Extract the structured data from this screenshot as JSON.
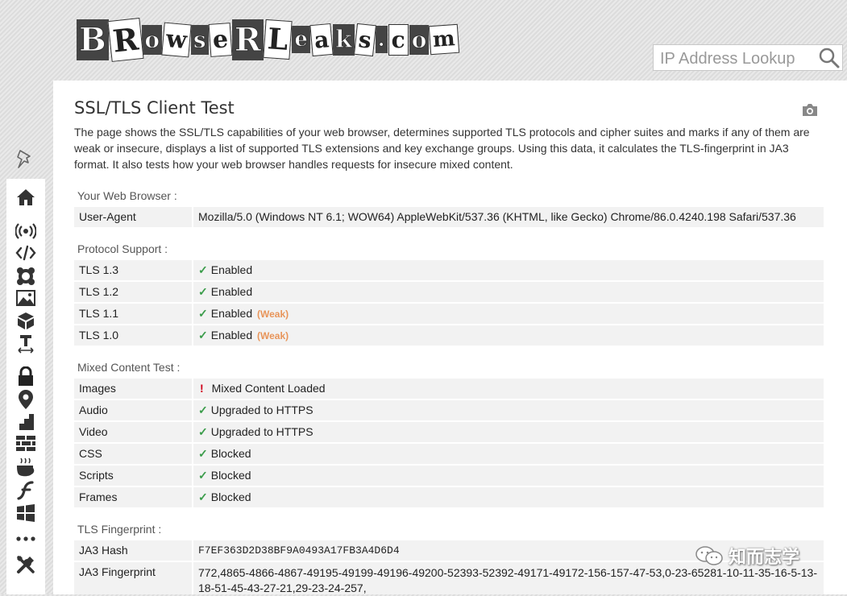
{
  "logo": {
    "letters": [
      "B",
      "R",
      "o",
      "w",
      "s",
      "e",
      "R",
      "L",
      "e",
      "a",
      "k",
      "s",
      ".",
      "c",
      "o",
      "m"
    ]
  },
  "search": {
    "placeholder": "IP Address Lookup"
  },
  "sidebar": {
    "icons": [
      "home-icon",
      "broadcast-icon",
      "code-icon",
      "flower-icon",
      "image-icon",
      "cube-icon",
      "text-size-icon",
      "lock-icon",
      "location-pin-icon",
      "bar-chart-icon",
      "brick-wall-icon",
      "coffee-icon",
      "flash-icon",
      "windows-icon",
      "more-icon",
      "tools-icon"
    ]
  },
  "page": {
    "title": "SSL/TLS Client Test",
    "description": "The page shows the SSL/TLS capabilities of your web browser, determines supported TLS protocols and cipher suites and marks if any of them are weak or insecure, displays a list of supported TLS extensions and key exchange groups. Using this data, it calculates the TLS-fingerprint in JA3 format. It also tests how your web browser handles requests for insecure mixed content."
  },
  "sections": {
    "browser": {
      "title": "Your Web Browser :",
      "rows": [
        {
          "key": "User-Agent",
          "value": "Mozilla/5.0 (Windows NT 6.1; WOW64) AppleWebKit/537.36 (KHTML, like Gecko) Chrome/86.0.4240.198 Safari/537.36"
        }
      ]
    },
    "protocol": {
      "title": "Protocol Support :",
      "rows": [
        {
          "key": "TLS 1.3",
          "value": "Enabled",
          "note": ""
        },
        {
          "key": "TLS 1.2",
          "value": "Enabled",
          "note": ""
        },
        {
          "key": "TLS 1.1",
          "value": "Enabled",
          "note": "(Weak)"
        },
        {
          "key": "TLS 1.0",
          "value": "Enabled",
          "note": "(Weak)"
        }
      ]
    },
    "mixed": {
      "title": "Mixed Content Test :",
      "rows": [
        {
          "key": "Images",
          "value": "Mixed Content Loaded",
          "mark": "!"
        },
        {
          "key": "Audio",
          "value": "Upgraded to HTTPS",
          "mark": "✓"
        },
        {
          "key": "Video",
          "value": "Upgraded to HTTPS",
          "mark": "✓"
        },
        {
          "key": "CSS",
          "value": "Blocked",
          "mark": "✓"
        },
        {
          "key": "Scripts",
          "value": "Blocked",
          "mark": "✓"
        },
        {
          "key": "Frames",
          "value": "Blocked",
          "mark": "✓"
        }
      ]
    },
    "fingerprint": {
      "title": "TLS Fingerprint :",
      "rows": [
        {
          "key": "JA3 Hash",
          "value": "F7EF363D2D38BF9A0493A17FB3A4D6D4"
        },
        {
          "key": "JA3 Fingerprint",
          "value": "772,4865-4866-4867-49195-49199-49196-49200-52393-52392-49171-49172-156-157-47-53,0-23-65281-10-11-35-16-5-13-18-51-45-43-27-21,29-23-24-257,"
        }
      ]
    }
  },
  "marks": {
    "check": "✓",
    "bang": "!"
  },
  "watermark": {
    "text": "知而志学"
  },
  "colors": {
    "check": "#3a9c4a",
    "weak": "#e8955a",
    "alert": "#d0021b"
  }
}
